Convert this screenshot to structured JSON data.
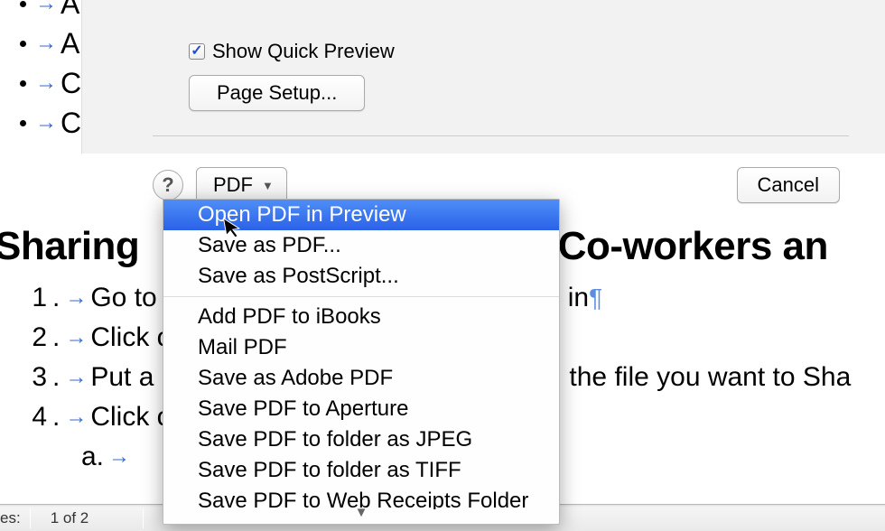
{
  "bullets": {
    "items": [
      {
        "letter": "A"
      },
      {
        "letter": "A"
      },
      {
        "letter": "C"
      },
      {
        "letter": "C"
      }
    ]
  },
  "dialog": {
    "pager_text": "of 2",
    "show_quick_preview_label": "Show Quick Preview",
    "page_setup_label": "Page Setup...",
    "help_label": "?",
    "pdf_label": "PDF",
    "cancel_label": "Cancel"
  },
  "dropdown": {
    "items_group1": [
      "Open PDF in Preview",
      "Save as PDF...",
      "Save as PostScript..."
    ],
    "items_group2": [
      "Add PDF to iBooks",
      "Mail PDF",
      "Save as Adobe PDF",
      "Save PDF to Aperture",
      "Save PDF to folder as JPEG",
      "Save PDF to folder as TIFF",
      "Save PDF to Web Receipts Folder"
    ],
    "more_indicator": "▼"
  },
  "doc_heading": {
    "left": "Sharing ",
    "right": " Co-workers an"
  },
  "doc_list": {
    "items": [
      {
        "n": "1",
        "text_before": "Go to ",
        "text_after": "in"
      },
      {
        "n": "2",
        "text_before": "Click on ",
        "text_after": ""
      },
      {
        "n": "3",
        "text_before": "Put a ",
        "text_after": "the file you want to Sha"
      },
      {
        "n": "4",
        "text_before": "Click on ",
        "text_after": ""
      }
    ],
    "sub": {
      "label": "a.",
      "text": ""
    }
  },
  "status": {
    "left_label": "es:",
    "page_text": "1 of 2"
  }
}
